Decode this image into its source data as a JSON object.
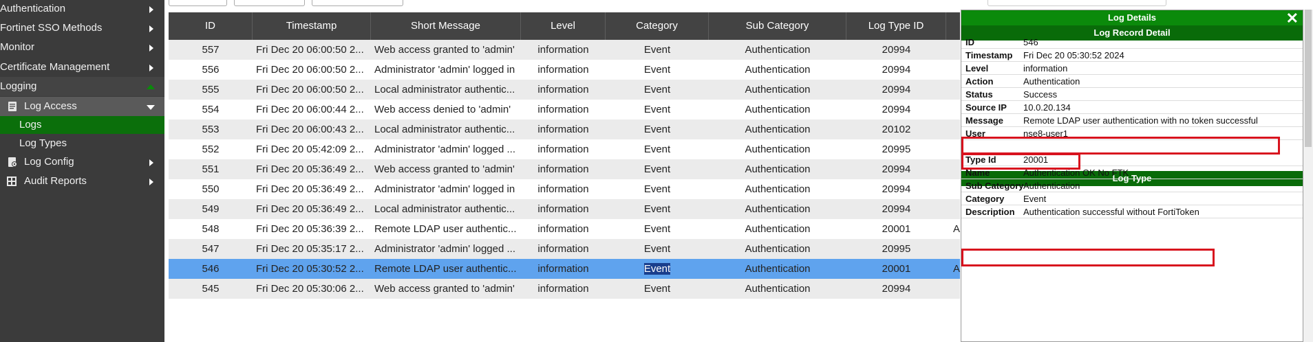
{
  "sidebar": {
    "items": [
      {
        "label": "Authentication",
        "arrow": "right"
      },
      {
        "label": "Fortinet SSO Methods",
        "arrow": "right"
      },
      {
        "label": "Monitor",
        "arrow": "right"
      },
      {
        "label": "Certificate Management",
        "arrow": "right"
      },
      {
        "label": "Logging",
        "arrow": "up"
      },
      {
        "label": "Log Access",
        "arrow": "down",
        "icon": "document-icon"
      },
      {
        "label": "Logs"
      },
      {
        "label": "Log Types"
      },
      {
        "label": "Log Config",
        "arrow": "right",
        "icon": "gear-document-icon"
      },
      {
        "label": "Audit Reports",
        "arrow": "right",
        "icon": "grid-icon"
      }
    ]
  },
  "table": {
    "columns": [
      "ID",
      "Timestamp",
      "Short Message",
      "Level",
      "Category",
      "Sub Category",
      "Log Type ID"
    ],
    "rows": [
      {
        "id": "557",
        "ts": "Fri Dec 20 06:00:50 2...",
        "msg": "Web access granted to 'admin'",
        "level": "information",
        "cat": "Event",
        "sub": "Authentication",
        "type": "20994",
        "extra": ""
      },
      {
        "id": "556",
        "ts": "Fri Dec 20 06:00:50 2...",
        "msg": "Administrator 'admin' logged in",
        "level": "information",
        "cat": "Event",
        "sub": "Authentication",
        "type": "20994",
        "extra": ""
      },
      {
        "id": "555",
        "ts": "Fri Dec 20 06:00:50 2...",
        "msg": "Local administrator authentic...",
        "level": "information",
        "cat": "Event",
        "sub": "Authentication",
        "type": "20994",
        "extra": ""
      },
      {
        "id": "554",
        "ts": "Fri Dec 20 06:00:44 2...",
        "msg": "Web access denied to 'admin'",
        "level": "information",
        "cat": "Event",
        "sub": "Authentication",
        "type": "20994",
        "extra": ""
      },
      {
        "id": "553",
        "ts": "Fri Dec 20 06:00:43 2...",
        "msg": "Local administrator authentic...",
        "level": "information",
        "cat": "Event",
        "sub": "Authentication",
        "type": "20102",
        "extra": ""
      },
      {
        "id": "552",
        "ts": "Fri Dec 20 05:42:09 2...",
        "msg": "Administrator 'admin' logged ...",
        "level": "information",
        "cat": "Event",
        "sub": "Authentication",
        "type": "20995",
        "extra": ""
      },
      {
        "id": "551",
        "ts": "Fri Dec 20 05:36:49 2...",
        "msg": "Web access granted to 'admin'",
        "level": "information",
        "cat": "Event",
        "sub": "Authentication",
        "type": "20994",
        "extra": ""
      },
      {
        "id": "550",
        "ts": "Fri Dec 20 05:36:49 2...",
        "msg": "Administrator 'admin' logged in",
        "level": "information",
        "cat": "Event",
        "sub": "Authentication",
        "type": "20994",
        "extra": ""
      },
      {
        "id": "549",
        "ts": "Fri Dec 20 05:36:49 2...",
        "msg": "Local administrator authentic...",
        "level": "information",
        "cat": "Event",
        "sub": "Authentication",
        "type": "20994",
        "extra": ""
      },
      {
        "id": "548",
        "ts": "Fri Dec 20 05:36:39 2...",
        "msg": "Remote LDAP user authentic...",
        "level": "information",
        "cat": "Event",
        "sub": "Authentication",
        "type": "20001",
        "extra": "A"
      },
      {
        "id": "547",
        "ts": "Fri Dec 20 05:35:17 2...",
        "msg": "Administrator 'admin' logged ...",
        "level": "information",
        "cat": "Event",
        "sub": "Authentication",
        "type": "20995",
        "extra": ""
      },
      {
        "id": "546",
        "ts": "Fri Dec 20 05:30:52 2...",
        "msg": "Remote LDAP user authentic...",
        "level": "information",
        "cat": "Event",
        "sub": "Authentication",
        "type": "20001",
        "extra": "A"
      },
      {
        "id": "545",
        "ts": "Fri Dec 20 05:30:06 2...",
        "msg": "Web access granted to 'admin'",
        "level": "information",
        "cat": "Event",
        "sub": "Authentication",
        "type": "20994",
        "extra": ""
      }
    ]
  },
  "panel": {
    "title": "Log Details",
    "record_header": "Log Record Detail",
    "record": [
      {
        "k": "ID",
        "v": "546"
      },
      {
        "k": "Timestamp",
        "v": "Fri Dec 20 05:30:52 2024"
      },
      {
        "k": "Level",
        "v": "information"
      },
      {
        "k": "Action",
        "v": "Authentication"
      },
      {
        "k": "Status",
        "v": "Success"
      },
      {
        "k": "Source IP",
        "v": "10.0.20.134"
      },
      {
        "k": "Message",
        "v": "Remote LDAP user authentication with no token successful"
      },
      {
        "k": "User",
        "v": "nse8-user1"
      }
    ],
    "type_header": "Log Type",
    "type": [
      {
        "k": "Type Id",
        "v": "20001"
      },
      {
        "k": "Name",
        "v": "Authentication OK No FTK"
      },
      {
        "k": "Sub Category",
        "v": "Authentication"
      },
      {
        "k": "Category",
        "v": "Event"
      },
      {
        "k": "Description",
        "v": "Authentication successful without FortiToken"
      }
    ]
  },
  "colors": {
    "accent_green": "#0b8a0b",
    "selected_row": "#5fa3ee",
    "highlight_box": "#d8131e",
    "sidebar_bg": "#3b3b3b"
  }
}
